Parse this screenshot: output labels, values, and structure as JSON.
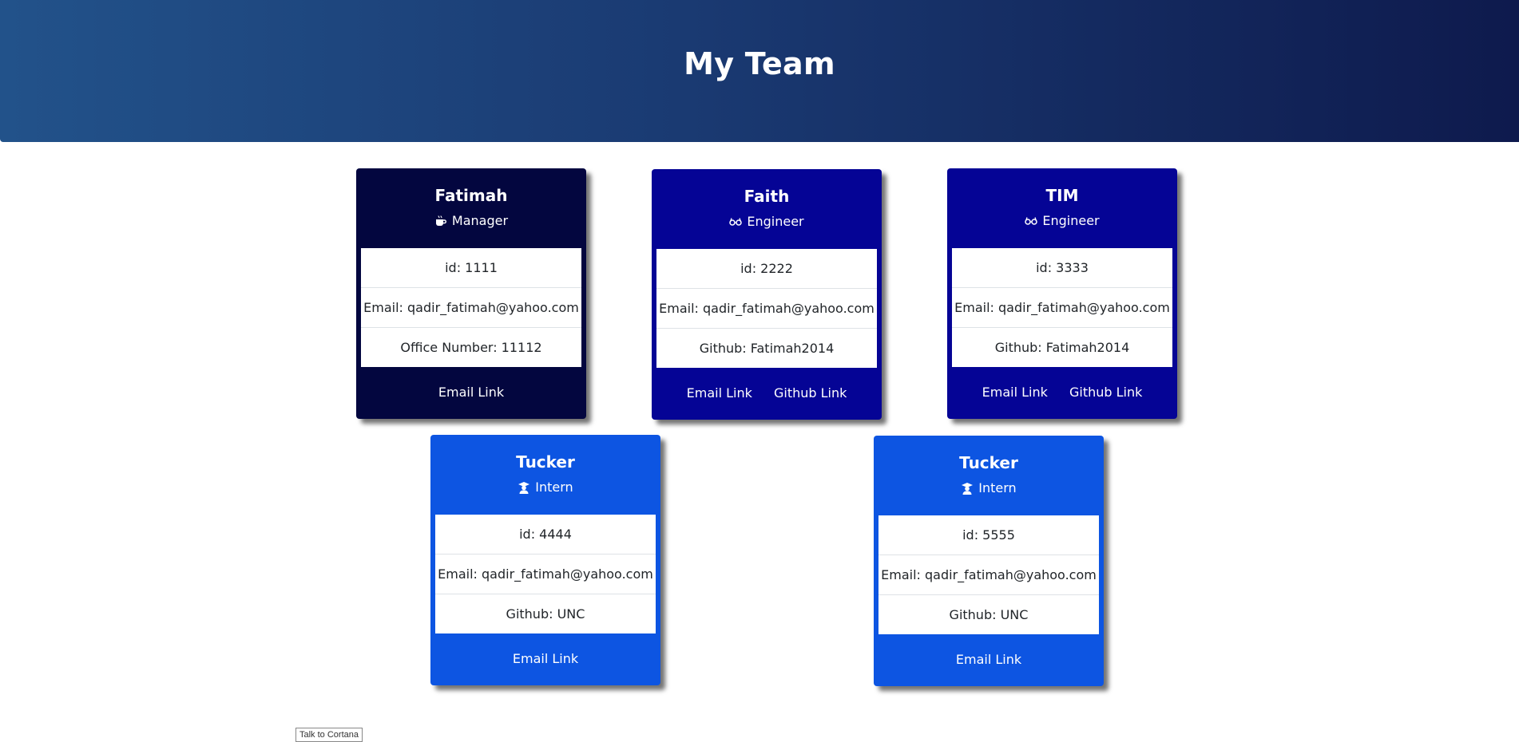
{
  "header": {
    "title": "My Team"
  },
  "cards": [
    {
      "name": "Fatimah",
      "role": "Manager",
      "role_icon": "coffee-cup-icon",
      "id_text": "id: 1111",
      "email_text": "Email: qadir_fatimah@yahoo.com",
      "extra_text": "Office Number: 11112",
      "email_link": "Email Link"
    },
    {
      "name": "Faith",
      "role": "Engineer",
      "role_icon": "glasses-icon",
      "id_text": "id: 2222",
      "email_text": "Email: qadir_fatimah@yahoo.com",
      "extra_text": "Github: Fatimah2014",
      "email_link": "Email Link",
      "github_link": "Github Link"
    },
    {
      "name": "TIM",
      "role": "Engineer",
      "role_icon": "glasses-icon",
      "id_text": "id: 3333",
      "email_text": "Email: qadir_fatimah@yahoo.com",
      "extra_text": "Github: Fatimah2014",
      "email_link": "Email Link",
      "github_link": "Github Link"
    },
    {
      "name": "Tucker",
      "role": "Intern",
      "role_icon": "graduate-icon",
      "id_text": "id: 4444",
      "email_text": "Email: qadir_fatimah@yahoo.com",
      "extra_text": "Github: UNC",
      "email_link": "Email Link"
    },
    {
      "name": "Tucker",
      "role": "Intern",
      "role_icon": "graduate-icon",
      "id_text": "id: 5555",
      "email_text": "Email: qadir_fatimah@yahoo.com",
      "extra_text": "Github: UNC",
      "email_link": "Email Link"
    }
  ],
  "colors": {
    "manager": "#03063f",
    "engineer": "#050495",
    "intern": "#0d55e2",
    "header_start": "#22528a",
    "header_end": "#0e1a4d"
  },
  "tooltip": {
    "text": "Talk to Cortana"
  }
}
